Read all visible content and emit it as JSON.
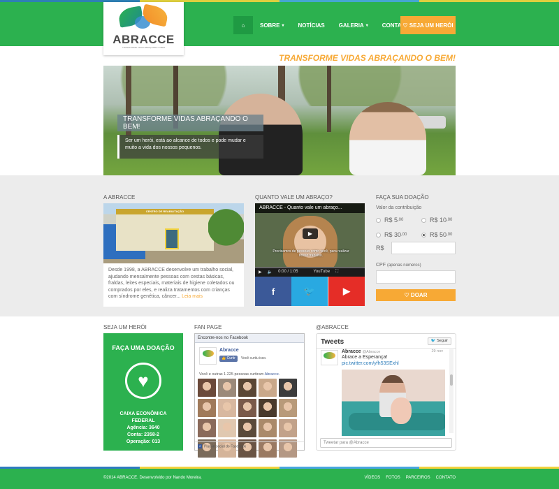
{
  "header": {
    "logo_name": "ABRACCE",
    "logo_tagline": "TRANSFORME VIDAS ABRAÇANDO O BEM",
    "nav": [
      {
        "label": "SOBRE",
        "caret": "▾"
      },
      {
        "label": "NOTÍCIAS"
      },
      {
        "label": "GALERIA",
        "caret": "▾"
      },
      {
        "label": "CONTATO"
      }
    ],
    "home_icon": "home-icon",
    "hero_button": "♡ SEJA UM HERÓI"
  },
  "tagline": "TRANSFORME VIDAS ABRAÇANDO O BEM!",
  "hero": {
    "caption_title": "TRANSFORME VIDAS ABRAÇANDO O BEM!",
    "caption_body": "Ser um herói, está ao alcance de todos e pode mudar e muito a vida dos nossos pequenos."
  },
  "about": {
    "title": "A ABRACCE",
    "sign": "CENTRO DE REABILITAÇÃO",
    "text": "Desde 1998, a ABRACCE desenvolve um trabalho social, ajudando mensalmente pessoas com cestas básicas, fraldas, leites especiais, materiais de higiene coletados ou comprados por eles, e realiza tratamentos com crianças com síndrome genética, câncer...",
    "more": "Leia mais"
  },
  "video": {
    "section_title": "QUANTO VALE UM ABRAÇO?",
    "title": "ABRACCE - Quanto vale um abraço...",
    "caption": "Precisamos de pessoas como você, para realizar nosso trabalho.",
    "time": "0:00 / 1:05",
    "progress": 0,
    "brand": "YouTube",
    "social": [
      {
        "label": "f",
        "color": "#3b5998",
        "icon": "facebook-icon"
      },
      {
        "label": "🐦",
        "color": "#29a9e1",
        "icon": "twitter-icon"
      },
      {
        "label": "▶",
        "color": "#e52d27",
        "icon": "youtube-icon"
      }
    ]
  },
  "donation": {
    "title": "FAÇA SUA DOAÇÃO",
    "label": "Valor da contribuição",
    "options": [
      {
        "main": "R$ 5",
        "cents": ",00",
        "selected": false
      },
      {
        "main": "R$ 10",
        "cents": ",00",
        "selected": false
      },
      {
        "main": "R$ 30",
        "cents": ",00",
        "selected": false
      },
      {
        "main": "R$ 50",
        "cents": ",00",
        "selected": true
      }
    ],
    "rs_label": "R$",
    "amount_value": "",
    "cpf_label": "CPF",
    "cpf_hint": "(apenas números)",
    "cpf_value": "",
    "button": "♡ DOAR"
  },
  "hero_section": {
    "title": "SEJA UM HERÓI",
    "box_title": "FAÇA UMA DOAÇÃO",
    "heart": "♥",
    "bank_lines": [
      "CAIXA ECONÔMICA",
      "FEDERAL",
      "Agência: 3640",
      "Conta: 2358-2",
      "Operação: 013"
    ]
  },
  "fanpage": {
    "title": "FAN PAGE",
    "header": "Encontre-nos no Facebook",
    "page_name": "Abracce",
    "like_button": "👍 Curtir",
    "liked": "Você curtiu isso.",
    "count_text": "Você e outras 1.225 pessoas curtiram",
    "count_link": "Abracce.",
    "plugin": "Plug-in social do Facebook",
    "face_colors": [
      "#6b4a3a",
      "#9b8a7a",
      "#5a4634",
      "#c9a88a",
      "#3c3c3c",
      "#a07a5a",
      "#d8b8a0",
      "#7a5a4a",
      "#4a3a2c",
      "#b89a7a",
      "#8a6a5a",
      "#e0c8b0",
      "#5a4a3a",
      "#aa8a6a",
      "#c2a28a",
      "#7a6a5a",
      "#d4b49a",
      "#6a5444",
      "#9a7a62",
      "#b49884"
    ]
  },
  "twitter": {
    "title": "@ABRACCE",
    "header": "Tweets",
    "follow": "🐦 Seguir",
    "name": "Abracce",
    "handle": "@Abracce",
    "date": "29 nov",
    "text": "Abrace a Esperança!",
    "link": "pic.twitter.com/yfh53SExhl",
    "compose": "Tweetar para @Abracce"
  },
  "footer": {
    "copyright": "©2014 ABRACCE. Desenvolvido por Nando Moreira.",
    "links": [
      "VÍDEOS",
      "FOTOS",
      "PARCEIROS",
      "CONTATO"
    ]
  },
  "colors": {
    "brand_green": "#2cb14f",
    "accent_orange": "#f7a935"
  }
}
